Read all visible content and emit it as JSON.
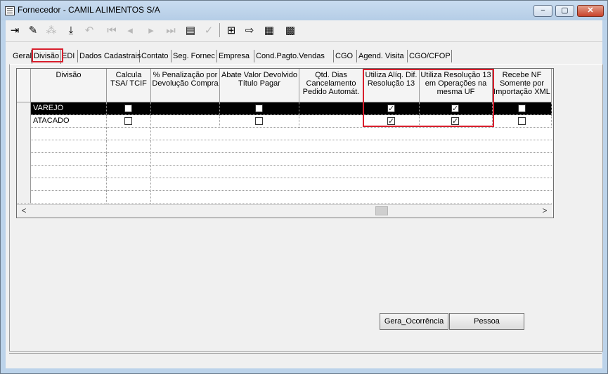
{
  "window": {
    "title": "Fornecedor - CAMIL ALIMENTOS S/A",
    "min": "−",
    "max": "▢",
    "close": "✕"
  },
  "toolbar": {
    "icons": [
      "exit-icon",
      "edit-icon",
      "tree-icon",
      "save-icon",
      "undo-icon",
      "first-icon",
      "prev-icon",
      "next-icon",
      "last-icon",
      "film-icon",
      "check-icon",
      "add-icon",
      "export-icon",
      "calc-icon",
      "grid-icon"
    ]
  },
  "tabs": [
    "Geral",
    "Divisão",
    "EDI",
    "Dados Cadastrais",
    "Contato",
    "Seg. Fornec",
    "Empresa",
    "Cond.Pagto.Vendas",
    "CGO",
    "Agend. Visita",
    "CGO/CFOP"
  ],
  "grid": {
    "columns": [
      "Divisão",
      "Calcula TSA/ TCIF",
      "% Penalização por Devolução Compra",
      "Abate Valor Devolvido Título Pagar",
      "Qtd. Dias Cancelamento Pedido Automát.",
      "Utiliza Alíq. Dif. Resolução 13",
      "Utiliza Resolução 13 em Operações na mesma UF",
      "Recebe NF Somente por Importação XML"
    ],
    "rows": [
      {
        "divisao": "VAREJO",
        "calcula": false,
        "abate": false,
        "aliq": true,
        "resol": true,
        "recebe": false
      },
      {
        "divisao": "ATACADO",
        "calcula": false,
        "abate": false,
        "aliq": true,
        "resol": true,
        "recebe": false
      }
    ],
    "scroll_left": "<",
    "scroll_right": ">"
  },
  "buttons": {
    "gera": "Gera_Ocorrência",
    "pessoa": "Pessoa"
  }
}
